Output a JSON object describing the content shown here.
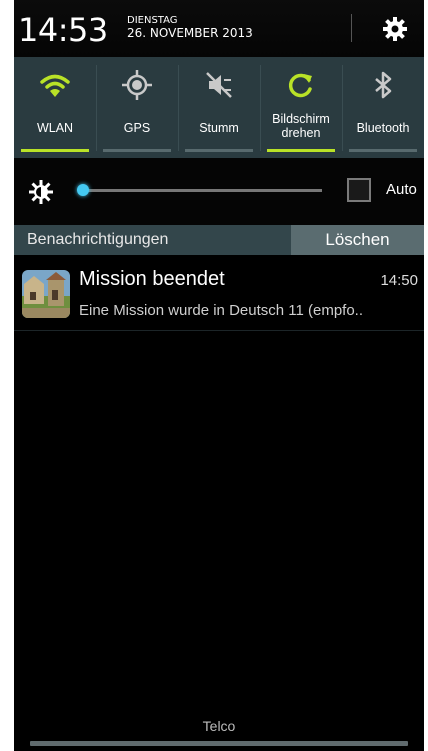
{
  "status": {
    "time": "14:53",
    "weekday": "DIENSTAG",
    "date": "26. NOVEMBER 2013",
    "settings_icon": "gear-icon"
  },
  "toggles": [
    {
      "label": "WLAN",
      "icon": "wifi-icon",
      "on": true
    },
    {
      "label": "GPS",
      "icon": "gps-icon",
      "on": false
    },
    {
      "label": "Stumm",
      "icon": "mute-icon",
      "on": false
    },
    {
      "label_line1": "Bildschirm",
      "label_line2": "drehen",
      "icon": "rotate-icon",
      "on": true
    },
    {
      "label": "Bluetooth",
      "icon": "bluetooth-icon",
      "on": false
    }
  ],
  "brightness": {
    "icon": "brightness-icon",
    "level": 0.02,
    "auto_label": "Auto",
    "auto_checked": false
  },
  "notifications_header": {
    "title": "Benachrichtigungen",
    "clear_label": "Löschen"
  },
  "notification": {
    "title": "Mission beendet",
    "time": "14:50",
    "text": "Eine Mission wurde in Deutsch 11 (empfo..",
    "icon": "app-icon"
  },
  "carrier": "Telco",
  "colors": {
    "accent_on": "#b9e227",
    "toggle_bg": "#2a3b40",
    "slider_thumb": "#44c9f2",
    "header_bg": "#33464b"
  }
}
